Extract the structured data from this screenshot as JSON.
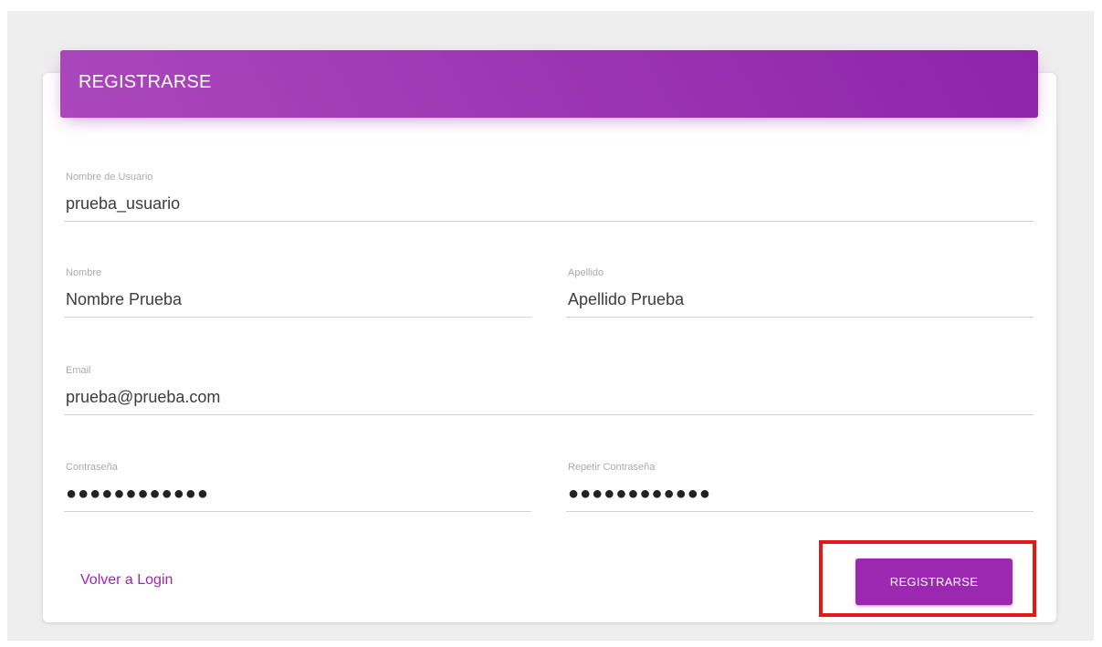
{
  "header": {
    "title": "REGISTRARSE"
  },
  "fields": {
    "username": {
      "label": "Nombre de Usuario",
      "value": "prueba_usuario"
    },
    "first_name": {
      "label": "Nombre",
      "value": "Nombre Prueba"
    },
    "last_name": {
      "label": "Apellido",
      "value": "Apellido Prueba"
    },
    "email": {
      "label": "Email",
      "value": "prueba@prueba.com"
    },
    "password": {
      "label": "Contraseña",
      "value": "●●●●●●●●●●●●"
    },
    "password_confirm": {
      "label": "Repetir Contraseña",
      "value": "●●●●●●●●●●●●"
    }
  },
  "actions": {
    "back_link": "Volver a Login",
    "submit": "REGISTRARSE"
  },
  "colors": {
    "primary": "#9c27b0",
    "primary_light": "#ab47bc",
    "highlight": "#e01818",
    "background": "#eeeeee"
  }
}
